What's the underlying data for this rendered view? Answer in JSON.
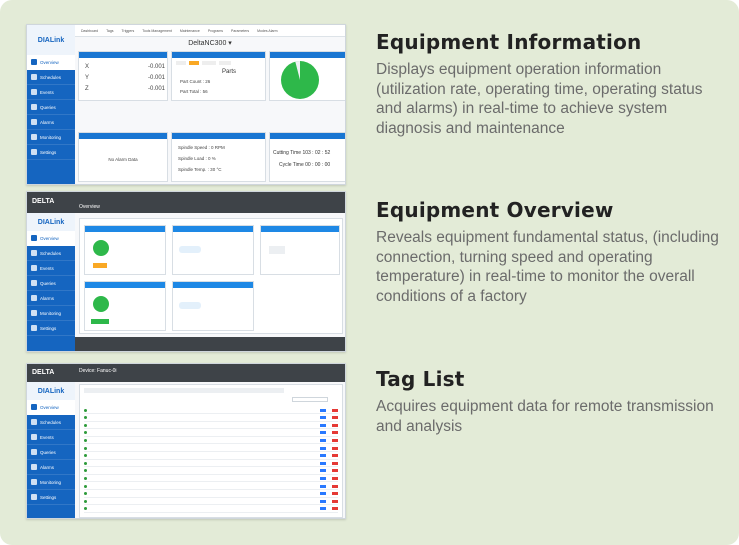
{
  "features": [
    {
      "title": "Equipment Information",
      "description": "Displays equipment operation information (utilization rate, operating time, operating status and alarms) in real-time to achieve system diagnosis and maintenance"
    },
    {
      "title": "Equipment Overview",
      "description": "Reveals equipment fundamental status, (including connection, turning speed and operating temperature) in real-time to monitor the overall conditions of a factory"
    },
    {
      "title": "Tag List",
      "description": "Acquires equipment data for remote transmission and analysis"
    }
  ],
  "app": {
    "brand": "DIALink",
    "vendor": "DELTA",
    "nav": [
      "Overview",
      "Schedules",
      "Events",
      "Queries",
      "Alarms",
      "Monitoring",
      "Settings"
    ]
  },
  "screen1": {
    "device": "DeltaNC300 ▾",
    "tabs": [
      "Dashboard",
      "Tags",
      "Triggers",
      "Tools Management",
      "Maintenance",
      "Programs",
      "Parameters",
      "Modes Alarm"
    ],
    "axes": [
      {
        "axis": "X",
        "value": "-0.001"
      },
      {
        "axis": "Y",
        "value": "-0.001"
      },
      {
        "axis": "Z",
        "value": "-0.001"
      }
    ],
    "parts_title": "Parts",
    "part_count": "Part Count : 26",
    "part_total": "Part Total : 56",
    "no_alarm": "No Alarm Data",
    "spindle_speed": "Spindle Speed : 0 RPM",
    "spindle_load": "Spindle Load : 0 %",
    "spindle_temp": "Spindle Temp. : 30 °C",
    "cutting_time": "Cutting Time  103 : 02 : 52",
    "cycle_time": "Cycle Time   00 : 00 : 00",
    "utilization": 0.96
  },
  "screen2": {
    "header": "Overview"
  },
  "screen3": {
    "device": "Device: Fanuc-0i",
    "rows": 14
  }
}
